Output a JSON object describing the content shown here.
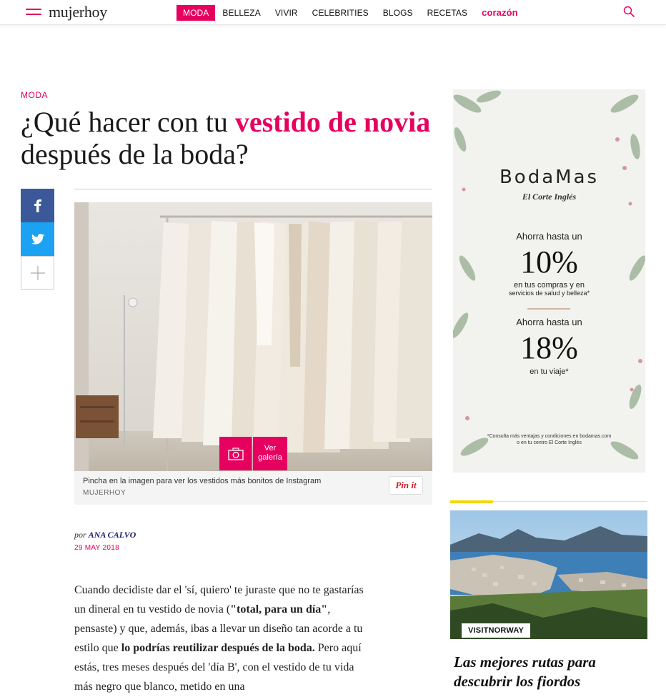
{
  "header": {
    "logo": "mujerhoy",
    "nav": [
      {
        "label": "MODA",
        "active": true
      },
      {
        "label": "BELLEZA"
      },
      {
        "label": "VIVIR"
      },
      {
        "label": "CELEBRITIES"
      },
      {
        "label": "BLOGS"
      },
      {
        "label": "RECETAS"
      },
      {
        "label": "corazón",
        "special": true
      }
    ],
    "search_icon": "search-icon",
    "menu_icon": "hamburger-menu-icon"
  },
  "article": {
    "section": "MODA",
    "title_part1": "¿Qué hacer con tu ",
    "title_highlight": "vestido de novia",
    "title_part2": " después de la boda?",
    "gallery_label_line1": "Ver",
    "gallery_label_line2": "galería",
    "caption": "Pincha en la imagen para ver los vestidos más bonitos de Instagram",
    "credit": "MUJERHOY",
    "pin_label": "Pin it",
    "byline_prefix": "por",
    "author": "ANA CALVO",
    "date": "29 MAY 2018",
    "body": {
      "p1_a": "Cuando decidiste dar el 'sí, quiero' te juraste que no te gastarías un dineral en tu vestido de novia (",
      "p1_b": "\"total, para un día\"",
      "p1_c": ", pensaste) y que, además, ibas a llevar un diseño tan acorde a tu estilo que ",
      "p1_d": "lo podrías reutilizar después de la boda.",
      "p1_e": " Pero aquí estás, tres meses después del 'día B', con el vestido de tu vida más negro que blanco, metido en una"
    }
  },
  "share": {
    "facebook_icon": "facebook-icon",
    "twitter_icon": "twitter-icon",
    "more_icon": "plus-icon"
  },
  "ad": {
    "brand": "BodaMas",
    "sub_brand": "El Corte Inglés",
    "offer1_label": "Ahorra hasta un",
    "offer1_value": "10%",
    "offer1_desc1": "en tus compras y en",
    "offer1_desc2": "servicios de salud y belleza*",
    "offer2_label": "Ahorra hasta un",
    "offer2_value": "18%",
    "offer2_desc": "en tu viaje*",
    "footnote1": "*Consulta más ventajas y condiciones en bodamas.com",
    "footnote2": "o en tu centro El Corte Inglés"
  },
  "promo": {
    "tag": "VISITNORWAY",
    "title": "Las mejores rutas para descubrir los fiordos"
  },
  "colors": {
    "brand_pink": "#e6005f",
    "facebook": "#3b5998",
    "twitter": "#1da1f2",
    "promo_yellow": "#f5d800"
  }
}
